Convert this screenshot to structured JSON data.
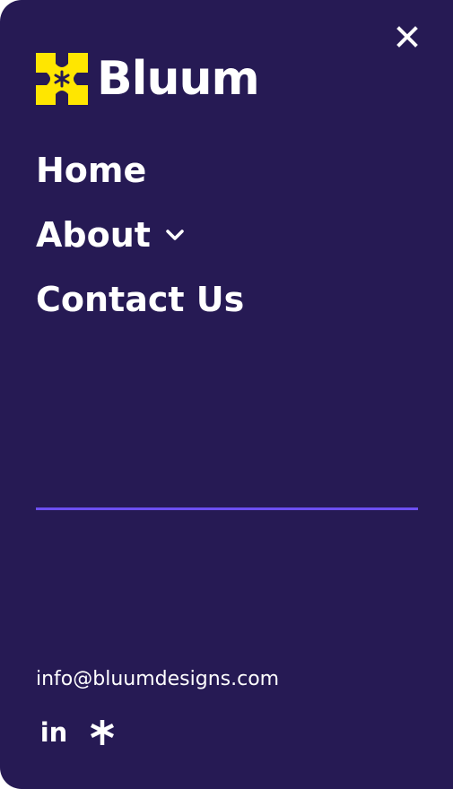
{
  "brand": {
    "name": "Bluum",
    "mark_color": "#ffe600",
    "mark_center_color": "#261a54"
  },
  "menu": {
    "background": "#261a54",
    "accent_divider": "#6d4ff2",
    "close_icon": "close-icon",
    "items": [
      {
        "label": "Home",
        "has_submenu": false
      },
      {
        "label": "About",
        "has_submenu": true,
        "submenu_icon": "chevron-down-icon"
      },
      {
        "label": "Contact Us",
        "has_submenu": false
      }
    ]
  },
  "footer": {
    "email": "info@bluumdesigns.com",
    "socials": [
      {
        "name": "linkedin-icon",
        "glyph": "in"
      },
      {
        "name": "asterisk-icon"
      }
    ]
  }
}
